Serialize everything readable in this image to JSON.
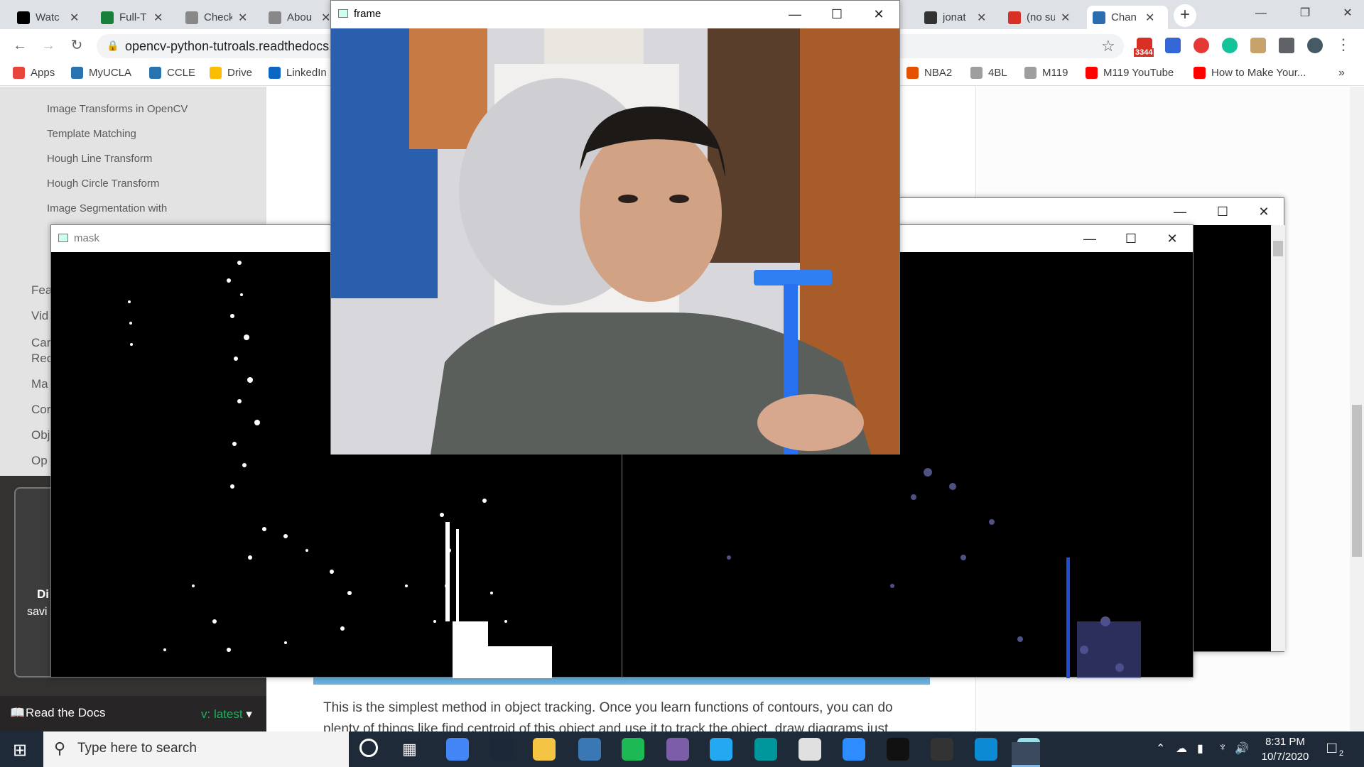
{
  "browser": {
    "tabs": [
      {
        "title": "Watc",
        "color": "#000000",
        "icon": "amazon-icon"
      },
      {
        "title": "Full-T",
        "color": "#188038",
        "icon": "sheets-icon"
      },
      {
        "title": "Check",
        "color": "#888888",
        "icon": "page-icon"
      },
      {
        "title": "Abou",
        "color": "#888888",
        "icon": "page-icon"
      },
      {
        "title": "jonat",
        "color": "#333333",
        "icon": "github-icon"
      },
      {
        "title": "(no su",
        "color": "#d93025",
        "icon": "gmail-icon"
      },
      {
        "title": "Chan",
        "color": "#2c6db0",
        "icon": "docs-icon"
      }
    ],
    "new_tab": "+",
    "url": "opencv-python-tutroals.readthedocs.",
    "gmail_badge": "3344",
    "bookmarks": [
      {
        "label": "Apps",
        "color": "#e8453c"
      },
      {
        "label": "MyUCLA",
        "color": "#2774ae"
      },
      {
        "label": "CCLE",
        "color": "#2774ae"
      },
      {
        "label": "Drive",
        "color": "#fbbc04"
      },
      {
        "label": "LinkedIn",
        "color": "#0a66c2"
      },
      {
        "label": "NBA2",
        "color": "#e65100"
      },
      {
        "label": "4BL",
        "color": "#9e9e9e"
      },
      {
        "label": "M119",
        "color": "#9e9e9e"
      },
      {
        "label": "M119 YouTube",
        "color": "#ff0000"
      },
      {
        "label": "How to Make Your...",
        "color": "#ff0000"
      }
    ],
    "bookmarks_more": "»"
  },
  "sidebar": {
    "sub_items": [
      "Image Transforms in OpenCV",
      "Template Matching",
      "Hough Line Transform",
      "Hough Circle Transform",
      "Image Segmentation with"
    ],
    "sections": [
      "Fea",
      "Vid",
      "Car",
      "Rec",
      "Ma",
      "Cor",
      "Obj",
      "Op"
    ],
    "card_text": [
      "Di",
      "savi"
    ],
    "rtd_label": "Read the Docs",
    "version": "v: latest"
  },
  "page": {
    "body_line1": "This is the simplest method in object tracking. Once you learn functions of contours, you can do",
    "body_line2": "plenty of things like find centroid of this object and use it to track the object, draw diagrams just"
  },
  "windows": {
    "frame_title": "frame",
    "mask_title": "mask",
    "res_title": ""
  },
  "taskbar": {
    "search_placeholder": "Type here to search",
    "time": "8:31 PM",
    "date": "10/7/2020",
    "notification_count": "2"
  }
}
